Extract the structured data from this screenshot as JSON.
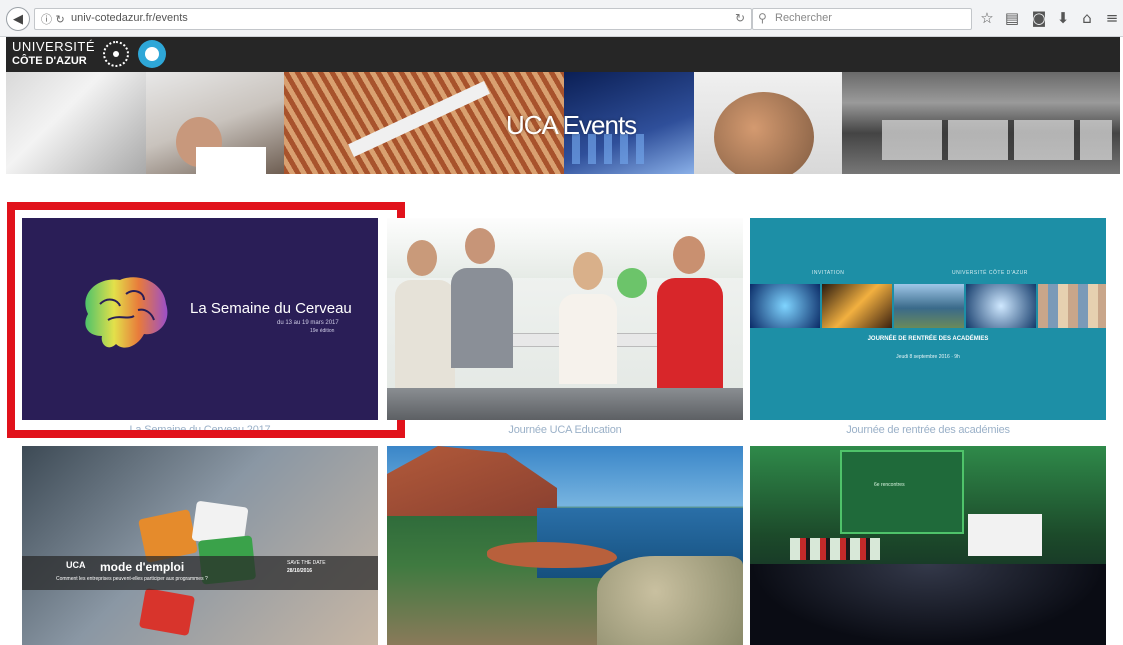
{
  "browser": {
    "url": "univ-cotedazur.fr/events",
    "search_placeholder": "Rechercher"
  },
  "site": {
    "logo_line1": "UNIVERSITÉ",
    "logo_line2": "CÔTE D'AZUR"
  },
  "banner": {
    "title": "UCA Events"
  },
  "events": [
    {
      "caption": "La Semaine du Cerveau 2017",
      "poster_title": "La Semaine du Cerveau",
      "poster_dates": "du 13 au 19 mars 2017",
      "poster_edition": "19e édition"
    },
    {
      "caption": "Journée UCA Education"
    },
    {
      "caption": "Journée de rentrée des académies",
      "poster_invitation": "INVITATION",
      "poster_university": "UNIVERSITÉ CÔTE D'AZUR",
      "poster_title": "JOURNÉE DE RENTRÉE DES ACADÉMIES",
      "poster_date": "Jeudi 8 septembre 2016 · 9h"
    },
    {
      "poster_uca": "UCA",
      "poster_title": "mode d'emploi",
      "poster_question": "Comment les entreprises peuvent-elles participer aux programmes ?",
      "poster_save": "SAVE THE DATE",
      "poster_date": "28/10/2016"
    },
    {},
    {
      "screen_text": "6e rencontres"
    }
  ],
  "colors": {
    "highlight": "#e1121b",
    "caption": "#9bb1c8",
    "brain_bg": "#2a1e57",
    "invitation_bg": "#1d8fa6"
  }
}
